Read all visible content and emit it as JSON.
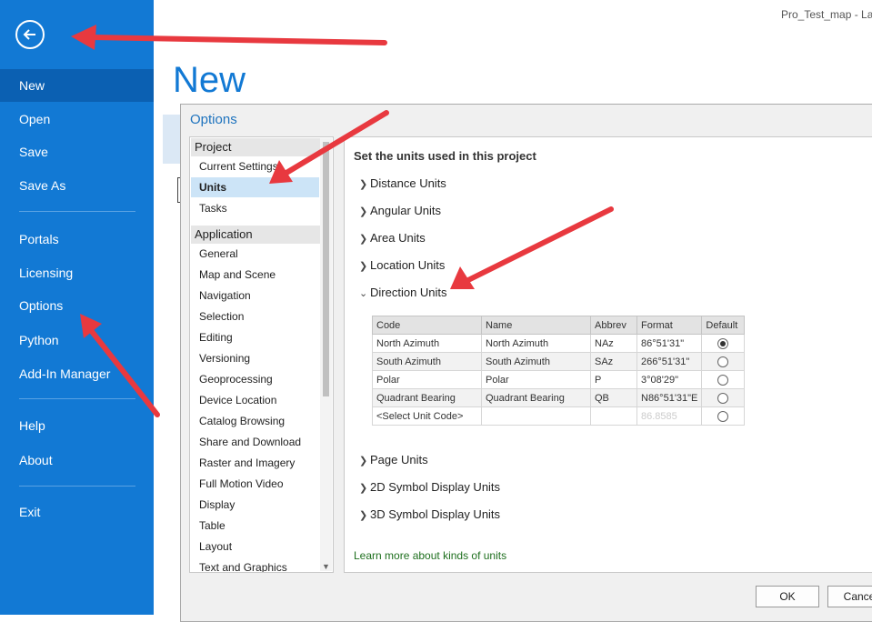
{
  "window": {
    "title": "Pro_Test_map - Lay"
  },
  "backstage": {
    "page_title": "New",
    "back_icon": "back-arrow-icon",
    "nav": [
      {
        "label": "New",
        "active": true
      },
      {
        "label": "Open"
      },
      {
        "label": "Save"
      },
      {
        "label": "Save As"
      },
      {
        "label": "Portals"
      },
      {
        "label": "Licensing"
      },
      {
        "label": "Options"
      },
      {
        "label": "Python"
      },
      {
        "label": "Add-In Manager"
      },
      {
        "label": "Help"
      },
      {
        "label": "About"
      },
      {
        "label": "Exit"
      }
    ]
  },
  "dialog": {
    "title": "Options",
    "categories": {
      "project_header": "Project",
      "project_items": [
        "Current Settings",
        "Units",
        "Tasks"
      ],
      "application_header": "Application",
      "application_items": [
        "General",
        "Map and Scene",
        "Navigation",
        "Selection",
        "Editing",
        "Versioning",
        "Geoprocessing",
        "Device Location",
        "Catalog Browsing",
        "Share and Download",
        "Raster and Imagery",
        "Full Motion Video",
        "Display",
        "Table",
        "Layout",
        "Text and Graphics"
      ],
      "selected": "Units"
    },
    "content": {
      "heading": "Set the units used in this project",
      "sections": [
        "Distance Units",
        "Angular Units",
        "Area Units",
        "Location Units",
        "Direction Units",
        "Page Units",
        "2D Symbol Display Units",
        "3D Symbol Display Units"
      ],
      "expanded": "Direction Units",
      "table": {
        "headers": [
          "Code",
          "Name",
          "Abbrev",
          "Format",
          "Default"
        ],
        "rows": [
          {
            "code": "North Azimuth",
            "name": "North Azimuth",
            "abbrev": "NAz",
            "format": "86°51'31\"",
            "default": true
          },
          {
            "code": "South Azimuth",
            "name": "South Azimuth",
            "abbrev": "SAz",
            "format": "266°51'31\"",
            "default": false
          },
          {
            "code": "Polar",
            "name": "Polar",
            "abbrev": "P",
            "format": "3°08'29\"",
            "default": false
          },
          {
            "code": "Quadrant Bearing",
            "name": "Quadrant Bearing",
            "abbrev": "QB",
            "format": "N86°51'31\"E",
            "default": false
          },
          {
            "code": "<Select Unit Code>",
            "name": "",
            "abbrev": "",
            "format": "86.8585",
            "default": false
          }
        ]
      },
      "learn_more": "Learn more about kinds of units"
    },
    "buttons": {
      "ok": "OK",
      "cancel": "Cance"
    }
  },
  "annotations": {
    "arrow_color": "#e8393f"
  }
}
